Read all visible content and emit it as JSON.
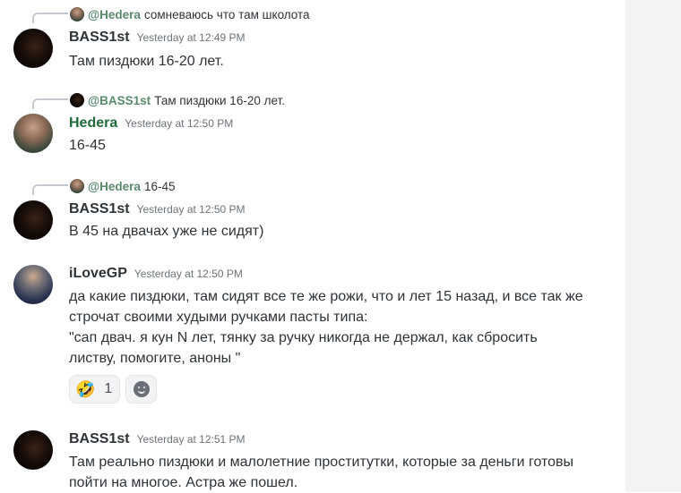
{
  "messages": [
    {
      "reply": {
        "name": "@Hedera",
        "text": "сомневаюсь что там школота"
      },
      "author": "BASS1st",
      "timestamp": "Yesterday at 12:49 PM",
      "lines": [
        "Там пиздюки 16-20 лет."
      ]
    },
    {
      "reply": {
        "name": "@BASS1st",
        "text": "Там пиздюки 16-20 лет."
      },
      "author": "Hedera",
      "timestamp": "Yesterday at 12:50 PM",
      "lines": [
        "16-45"
      ]
    },
    {
      "reply": {
        "name": "@Hedera",
        "text": "16-45"
      },
      "author": "BASS1st",
      "timestamp": "Yesterday at 12:50 PM",
      "lines": [
        "В 45 на двачах уже не сидят)"
      ]
    },
    {
      "author": "iLoveGP",
      "timestamp": "Yesterday at 12:50 PM",
      "lines": [
        "да какие пиздюки, там сидят все те же рожи, что и лет 15 назад, и все так же",
        "строчат своими худыми ручками пасты типа:",
        "\"сап двач. я кун N лет, тянку за ручку никогда не держал, как сбросить",
        "листву, помогите, аноны \""
      ],
      "reactions": [
        {
          "emoji": "🤣",
          "count": "1"
        }
      ],
      "add_reaction_icon": "add-reaction-smile-icon"
    },
    {
      "author": "BASS1st",
      "timestamp": "Yesterday at 12:51 PM",
      "lines": [
        "Там реально пиздюки и малолетние проститутки, которые за деньги готовы",
        "пойти на многое. Астра же пошел."
      ]
    }
  ],
  "colors": {
    "username_hedera": "#1f6b3a",
    "reply_mention": "#5a8a6e",
    "timestamp": "#6d737a",
    "text": "#2e3338"
  }
}
